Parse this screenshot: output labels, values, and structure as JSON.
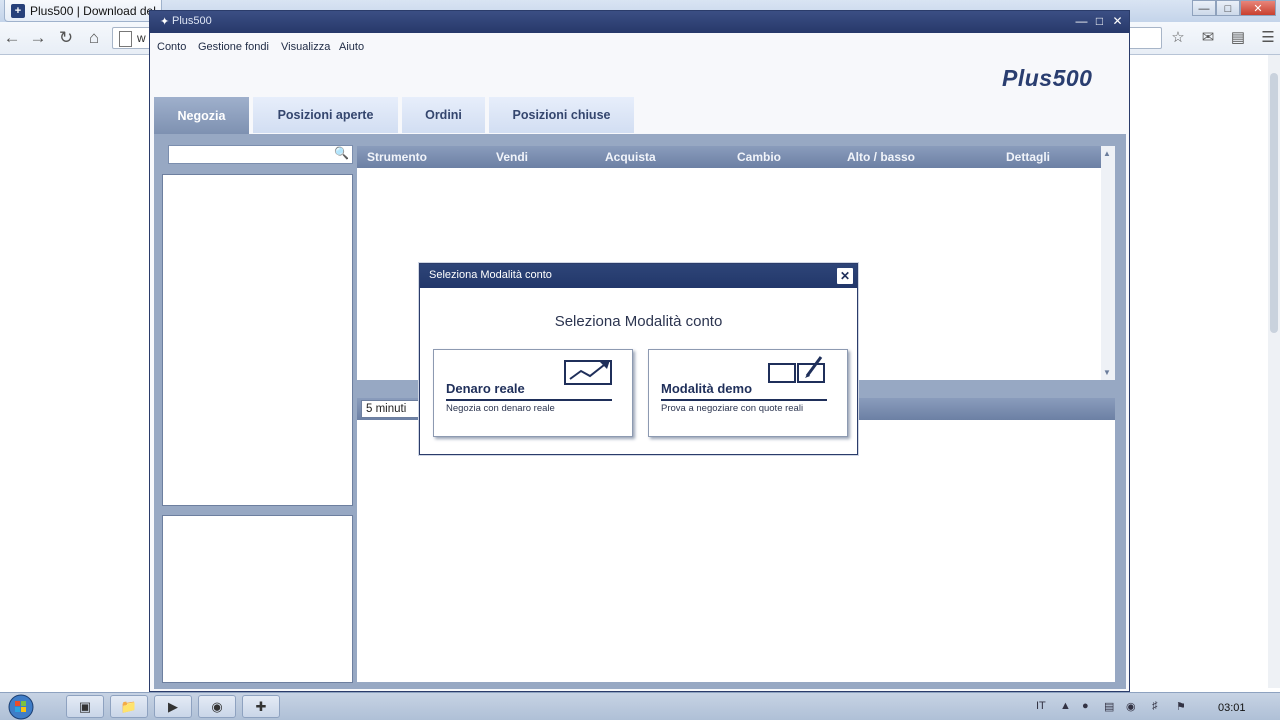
{
  "browser": {
    "tab_title": "Plus500 | Download del",
    "url_text": "w"
  },
  "app": {
    "window_title": "Plus500",
    "menu": [
      "Conto",
      "Gestione fondi",
      "Visualizza",
      "Aiuto"
    ],
    "logo": "Plus500",
    "tabs": [
      {
        "label": "Negozia",
        "active": true
      },
      {
        "label": "Posizioni aperte",
        "active": false
      },
      {
        "label": "Ordini",
        "active": false
      },
      {
        "label": "Posizioni chiuse",
        "active": false
      }
    ],
    "search_placeholder": "",
    "grid_columns": [
      "Strumento",
      "Vendi",
      "Acquista",
      "Cambio",
      "Alto / basso",
      "Dettagli"
    ],
    "timeframe": "5 minuti"
  },
  "modal": {
    "title": "Seleziona Modalità conto",
    "heading": "Seleziona Modalità conto",
    "options": [
      {
        "name": "Denaro reale",
        "description": "Negozia con denaro reale",
        "icon": "rising-chart-icon"
      },
      {
        "name": "Modalità demo",
        "description": "Prova a negoziare con quote reali",
        "icon": "demo-screens-icon"
      }
    ]
  },
  "taskbar": {
    "language": "IT",
    "clock": "03:01"
  },
  "colors": {
    "title_bar": "#27396a",
    "accent_navy": "#1f2f5a",
    "panel_bg": "#97a8c3"
  }
}
